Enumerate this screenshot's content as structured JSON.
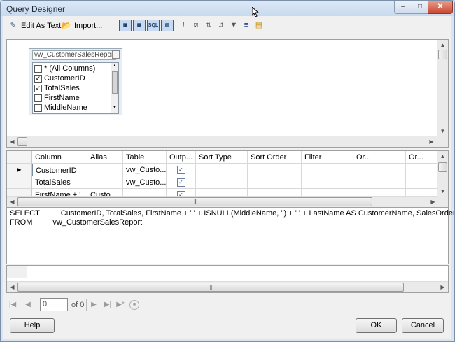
{
  "window": {
    "title": "Query Designer"
  },
  "toolbar": {
    "edit_as_text": "Edit As Text",
    "import": "Import..."
  },
  "diagram": {
    "table_name": "vw_CustomerSalesReport",
    "columns": [
      {
        "label": "* (All Columns)",
        "checked": false
      },
      {
        "label": "CustomerID",
        "checked": true
      },
      {
        "label": "TotalSales",
        "checked": true
      },
      {
        "label": "FirstName",
        "checked": false
      },
      {
        "label": "MiddleName",
        "checked": false
      }
    ]
  },
  "criteria": {
    "headers": [
      "Column",
      "Alias",
      "Table",
      "Outp...",
      "Sort Type",
      "Sort Order",
      "Filter",
      "Or...",
      "Or..."
    ],
    "rows": [
      {
        "column": "CustomerID",
        "alias": "",
        "table": "vw_Custo...",
        "output": true,
        "current": true
      },
      {
        "column": "TotalSales",
        "alias": "",
        "table": "vw_Custo...",
        "output": true,
        "current": false
      },
      {
        "column": "FirstName + '...",
        "alias": "Custo...",
        "table": "",
        "output": true,
        "current": false
      }
    ]
  },
  "sql": {
    "select_keyword": "SELECT",
    "select_clause": "CustomerID, TotalSales, FirstName + ' ' + ISNULL(MiddleName, '') + ' ' + LastName AS CustomerName, SalesOrders",
    "from_keyword": "FROM",
    "from_clause": "vw_CustomerSalesReport"
  },
  "navigation": {
    "record_value": "0",
    "of_label": "of 0"
  },
  "buttons": {
    "help": "Help",
    "ok": "OK",
    "cancel": "Cancel"
  }
}
